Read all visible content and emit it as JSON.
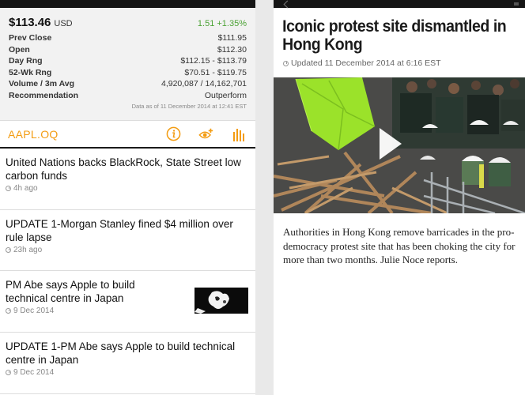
{
  "quote": {
    "price": "$113.46",
    "currency": "USD",
    "change": "1.51 +1.35%",
    "stats": [
      {
        "label": "Prev Close",
        "value": "$111.95"
      },
      {
        "label": "Open",
        "value": "$112.30"
      },
      {
        "label": "Day Rng",
        "value": "$112.15 - $113.79"
      },
      {
        "label": "52-Wk Rng",
        "value": "$70.51 - $119.75"
      },
      {
        "label": "Volume / 3m Avg",
        "value": "4,920,087 / 14,162,701"
      },
      {
        "label": "Recommendation",
        "value": "Outperform"
      }
    ],
    "as_of": "Data as of 11 December 2014 at 12:41 EST"
  },
  "ticker": {
    "symbol": "AAPL.OQ",
    "icons": [
      "info-icon",
      "watchlist-add-icon",
      "chart-icon"
    ]
  },
  "news": [
    {
      "title": "United Nations backs BlackRock, State Street low carbon funds",
      "time": "4h ago"
    },
    {
      "title": "UPDATE 1-Morgan Stanley fined $4 million over rule lapse",
      "time": "23h ago"
    },
    {
      "title": "PM Abe says Apple to build technical centre in Japan",
      "time": "9 Dec 2014"
    },
    {
      "title": "UPDATE 1-PM Abe says Apple to build technical centre in Japan",
      "time": "9 Dec 2014"
    }
  ],
  "article": {
    "title": "Iconic protest site dismantled in Hong Kong",
    "updated": "Updated 11 December 2014 at 6:16 EST",
    "body": "Authorities in Hong Kong remove barricades in the pro-democracy protest site that has been choking the city for more than two months. Julie Noce reports."
  },
  "colors": {
    "accent": "#f39c12",
    "positive": "#4ba234",
    "umbrella": "#9be22a"
  }
}
